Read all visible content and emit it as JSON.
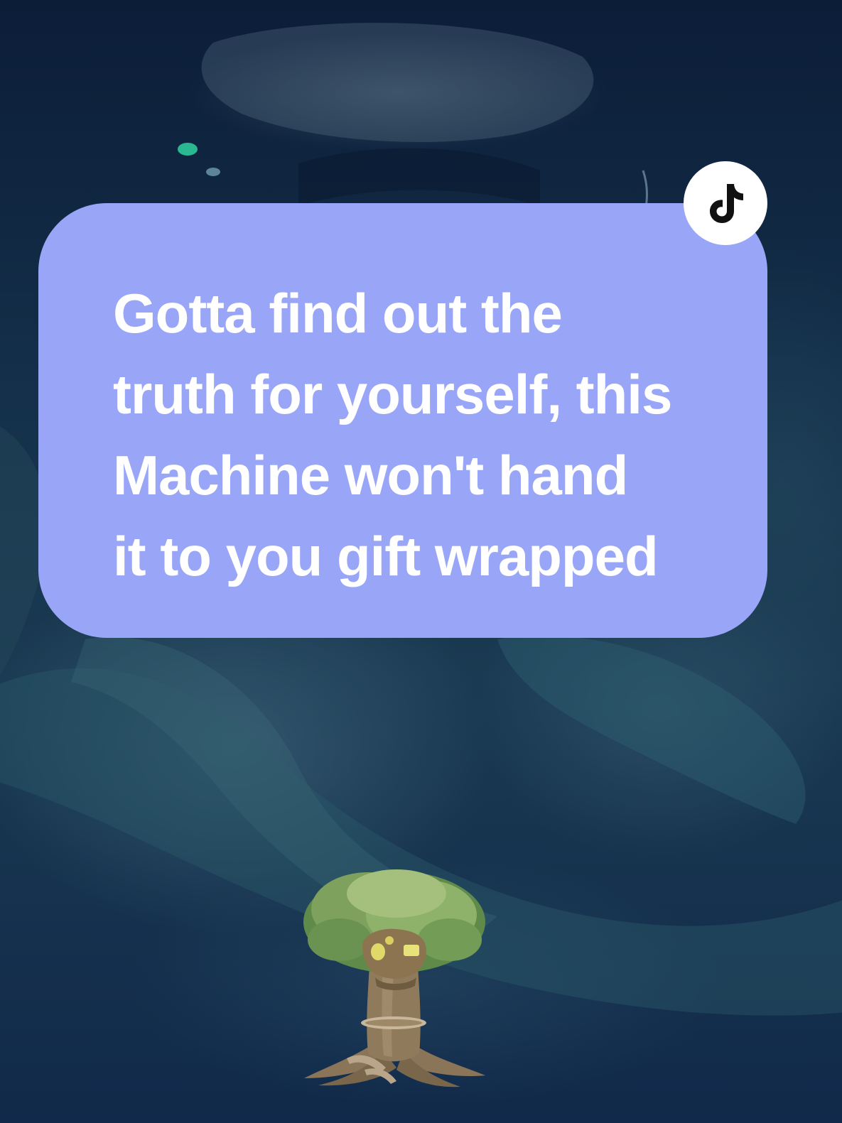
{
  "caption": {
    "text": "Gotta find out the\ntruth for yourself, this\nMachine won't hand\nit to you gift wrapped",
    "background_color": "#99a6f7",
    "text_color": "#ffffff"
  },
  "badge": {
    "icon": "tiktok-logo-icon",
    "background_color": "#ffffff",
    "icon_color": "#111111"
  },
  "illustration": {
    "icon": "treehouse-icon"
  }
}
